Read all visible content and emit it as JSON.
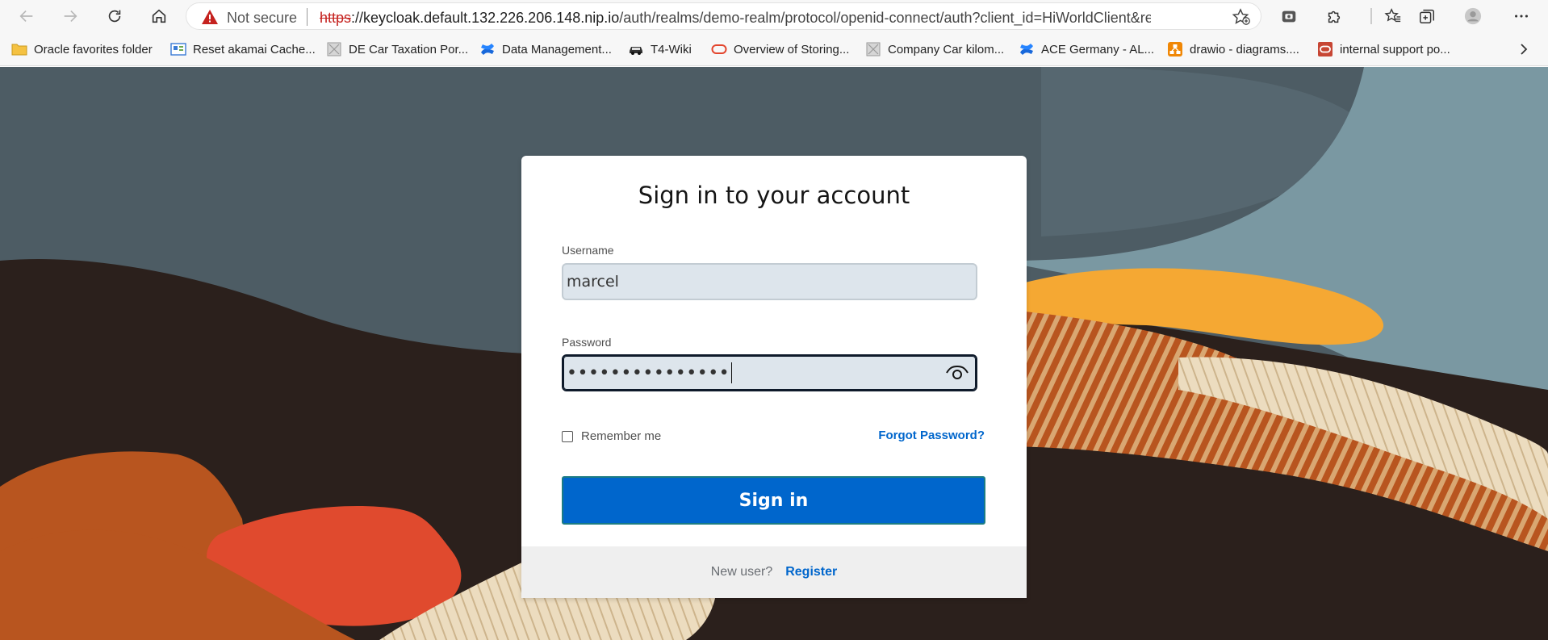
{
  "browser": {
    "security_label": "Not secure",
    "url_scheme": "https",
    "url_rest_host": "://keycloak.default.132.226.206.148.nip.io",
    "url_path": "/auth/realms/demo-realm/protocol/openid-connect/auth?client_id=HiWorldClient&redirect_uri...",
    "icons": [
      "back-icon",
      "forward-icon",
      "reload-icon",
      "home-icon",
      "favorite-add-icon",
      "extension-icon",
      "puzzle-icon",
      "favorites-icon",
      "collections-icon",
      "profile-icon",
      "menu-icon"
    ]
  },
  "bookmarks": [
    {
      "label": "Oracle favorites folder",
      "icon": "folder-icon"
    },
    {
      "label": "Reset akamai Cache...",
      "icon": "page-icon"
    },
    {
      "label": "DE Car Taxation Por...",
      "icon": "generic-icon"
    },
    {
      "label": "Data Management...",
      "icon": "confluence-icon"
    },
    {
      "label": "T4-Wiki",
      "icon": "car-icon"
    },
    {
      "label": "Overview of Storing...",
      "icon": "oracle-icon"
    },
    {
      "label": "Company Car kilom...",
      "icon": "generic-icon"
    },
    {
      "label": "ACE Germany - AL...",
      "icon": "confluence-icon"
    },
    {
      "label": "drawio - diagrams....",
      "icon": "drawio-icon"
    },
    {
      "label": "internal support po...",
      "icon": "oracle-red-icon"
    }
  ],
  "login": {
    "title": "Sign in to your account",
    "username_label": "Username",
    "username_value": "marcel",
    "password_label": "Password",
    "password_value": "•••••••••••••••",
    "remember_label": "Remember me",
    "forgot_label": "Forgot Password?",
    "signin_label": "Sign in",
    "new_user_label": "New user?",
    "register_label": "Register"
  },
  "colors": {
    "primary": "#0066cc",
    "bg_slate": "#4b5a62",
    "bg_dark": "#2b201c",
    "bg_orange": "#f5a833",
    "bg_rust": "#b8551f",
    "bg_red": "#e04a2e",
    "bg_cream": "#e9dbc0"
  }
}
